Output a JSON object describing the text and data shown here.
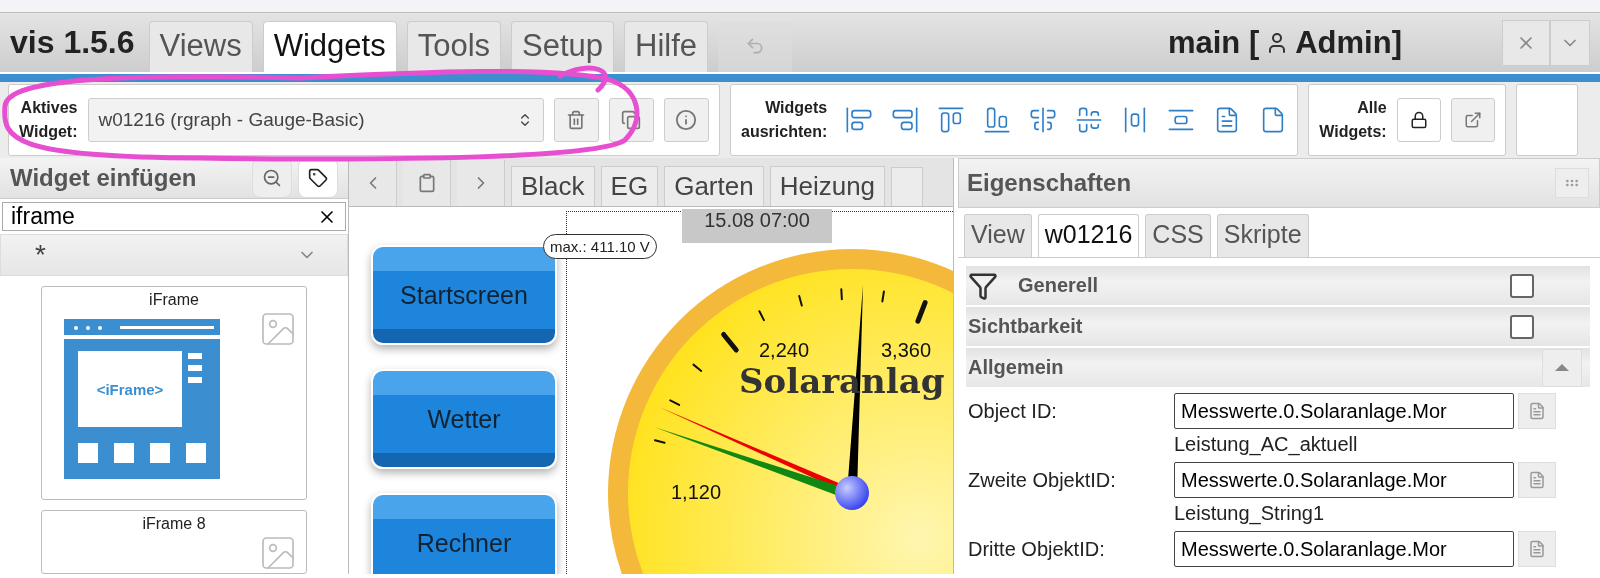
{
  "app": {
    "title": "vis 1.5.6"
  },
  "menu_tabs": [
    {
      "label": "Views",
      "selected": false
    },
    {
      "label": "Widgets",
      "selected": true
    },
    {
      "label": "Tools",
      "selected": false
    },
    {
      "label": "Setup",
      "selected": false
    },
    {
      "label": "Hilfe",
      "selected": false
    }
  ],
  "undo": {
    "disabled": true
  },
  "project": {
    "name": "main [",
    "user": "Admin]"
  },
  "toolbar": {
    "active_widget": {
      "label": "Aktives Widget:",
      "value": "w01216 (rgraph - Gauge-Basic)"
    },
    "align": {
      "label": "Widgets ausrichten:"
    },
    "all_widgets": {
      "label": "Alle Widgets:"
    }
  },
  "widget_panel": {
    "title": "Widget einfügen",
    "search": "iframe",
    "filter": "*",
    "widgets": [
      {
        "name": "iFrame",
        "art": "<iFrame>"
      },
      {
        "name": "iFrame 8"
      }
    ]
  },
  "view_tabs": [
    {
      "label": "Black",
      "selected": false
    },
    {
      "label": "EG",
      "selected": false
    },
    {
      "label": "Garten",
      "selected": false
    },
    {
      "label": "Heizung",
      "selected": false
    }
  ],
  "canvas": {
    "buttons": [
      "Startscreen",
      "Wetter",
      "Rechner"
    ],
    "timestamp": "15.08 07:00",
    "max_label": "max.: 411.10 V",
    "gauge": {
      "title": "Solaranlag",
      "labels": [
        "1,120",
        "2,240",
        "3,360"
      ]
    }
  },
  "properties": {
    "title": "Eigenschaften",
    "tabs": [
      {
        "label": "View",
        "selected": false
      },
      {
        "label": "w01216",
        "selected": true
      },
      {
        "label": "CSS",
        "selected": false
      },
      {
        "label": "Skripte",
        "selected": false
      }
    ],
    "sections": [
      {
        "label": "Generell",
        "kind": "filter",
        "checked": false
      },
      {
        "label": "Sichtbarkeit",
        "kind": "check",
        "checked": false
      },
      {
        "label": "Allgemein",
        "kind": "collapse",
        "expanded": true
      }
    ],
    "fields": [
      {
        "label": "Object ID:",
        "value": "Messwerte.0.Solaranlage.Mor",
        "hint": "Leistung_AC_aktuell"
      },
      {
        "label": "Zweite ObjektID:",
        "value": "Messwerte.0.Solaranlage.Mor",
        "hint": "Leistung_String1"
      },
      {
        "label": "Dritte ObjektID:",
        "value": "Messwerte.0.Solaranlage.Mor"
      }
    ]
  },
  "annotation": {
    "kind": "circle"
  }
}
